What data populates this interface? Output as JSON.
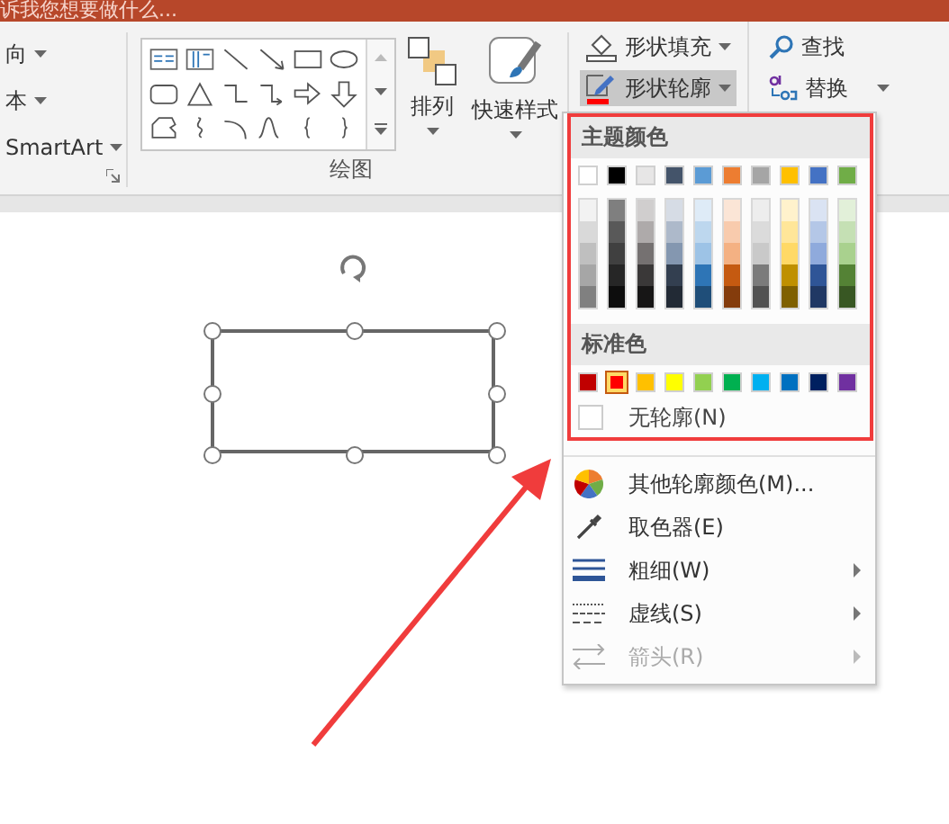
{
  "title_bar": {
    "search_hint": "诉我您想要做什么..."
  },
  "ribbon": {
    "left_items": [
      "向",
      "本",
      "SmartArt"
    ],
    "arrange_label": "排列",
    "quick_styles_label": "快速样式",
    "group_label": "绘图",
    "shape_buttons": [
      {
        "label": "形状填充",
        "kind": "fill",
        "pressed": false
      },
      {
        "label": "形状轮廓",
        "kind": "outline",
        "pressed": true
      }
    ],
    "edit_buttons": [
      {
        "label": "查找",
        "kind": "find",
        "dropdown": false
      },
      {
        "label": "替换",
        "kind": "replace",
        "dropdown": true
      }
    ]
  },
  "outline_menu": {
    "theme_header": "主题颜色",
    "theme_colors": [
      {
        "color": "#ffffff",
        "shades": [
          {
            "color": "#f2f2f2"
          },
          {
            "color": "#d9d9d9"
          },
          {
            "color": "#bfbfbf"
          },
          {
            "color": "#a6a6a6"
          },
          {
            "color": "#808080"
          }
        ]
      },
      {
        "color": "#000000",
        "shades": [
          {
            "color": "#7f7f7f"
          },
          {
            "color": "#595959"
          },
          {
            "color": "#404040"
          },
          {
            "color": "#262626"
          },
          {
            "color": "#0d0d0d"
          }
        ]
      },
      {
        "color": "#e7e6e6",
        "shades": [
          {
            "color": "#d0cece"
          },
          {
            "color": "#aeaaaa"
          },
          {
            "color": "#757171"
          },
          {
            "color": "#3a3838"
          },
          {
            "color": "#171616"
          }
        ]
      },
      {
        "color": "#44546a",
        "shades": [
          {
            "color": "#d6dce5"
          },
          {
            "color": "#adb9ca"
          },
          {
            "color": "#8497b0"
          },
          {
            "color": "#333f50"
          },
          {
            "color": "#222a35"
          }
        ]
      },
      {
        "color": "#5b9bd5",
        "shades": [
          {
            "color": "#deebf7"
          },
          {
            "color": "#bdd7ee"
          },
          {
            "color": "#9dc3e6"
          },
          {
            "color": "#2e75b6"
          },
          {
            "color": "#1f4e79"
          }
        ]
      },
      {
        "color": "#ed7d31",
        "shades": [
          {
            "color": "#fbe5d6"
          },
          {
            "color": "#f8cbad"
          },
          {
            "color": "#f4b183"
          },
          {
            "color": "#c55a11"
          },
          {
            "color": "#843c0c"
          }
        ]
      },
      {
        "color": "#a5a5a5",
        "shades": [
          {
            "color": "#ededed"
          },
          {
            "color": "#dbdbdb"
          },
          {
            "color": "#c9c9c9"
          },
          {
            "color": "#7b7b7b"
          },
          {
            "color": "#525252"
          }
        ]
      },
      {
        "color": "#ffc000",
        "shades": [
          {
            "color": "#fff2cc"
          },
          {
            "color": "#ffe699"
          },
          {
            "color": "#ffd966"
          },
          {
            "color": "#bf9000"
          },
          {
            "color": "#7f6000"
          }
        ]
      },
      {
        "color": "#4472c4",
        "shades": [
          {
            "color": "#dae3f3"
          },
          {
            "color": "#b4c7e7"
          },
          {
            "color": "#8faadc"
          },
          {
            "color": "#2f5597"
          },
          {
            "color": "#203864"
          }
        ]
      },
      {
        "color": "#70ad47",
        "shades": [
          {
            "color": "#e2f0d9"
          },
          {
            "color": "#c5e0b4"
          },
          {
            "color": "#a9d18e"
          },
          {
            "color": "#548235"
          },
          {
            "color": "#385723"
          }
        ]
      }
    ],
    "standard_header": "标准色",
    "standard_colors": [
      {
        "color": "#c00000",
        "selected": false
      },
      {
        "color": "#ff0000",
        "selected": true
      },
      {
        "color": "#ffc000",
        "selected": false
      },
      {
        "color": "#ffff00",
        "selected": false
      },
      {
        "color": "#92d050",
        "selected": false
      },
      {
        "color": "#00b050",
        "selected": false
      },
      {
        "color": "#00b0f0",
        "selected": false
      },
      {
        "color": "#0070c0",
        "selected": false
      },
      {
        "color": "#002060",
        "selected": false
      },
      {
        "color": "#7030a0",
        "selected": false
      }
    ],
    "no_outline": "无轮廓(N)",
    "items": [
      {
        "label": "其他轮廓颜色(M)...",
        "kind": "palette",
        "submenu": false,
        "disabled": false
      },
      {
        "label": "取色器(E)",
        "kind": "eyedropper",
        "submenu": false,
        "disabled": false
      },
      {
        "label": "粗细(W)",
        "kind": "weight",
        "submenu": true,
        "disabled": false
      },
      {
        "label": "虚线(S)",
        "kind": "dashes",
        "submenu": true,
        "disabled": false
      },
      {
        "label": "箭头(R)",
        "kind": "arrows",
        "submenu": true,
        "disabled": true
      }
    ]
  }
}
